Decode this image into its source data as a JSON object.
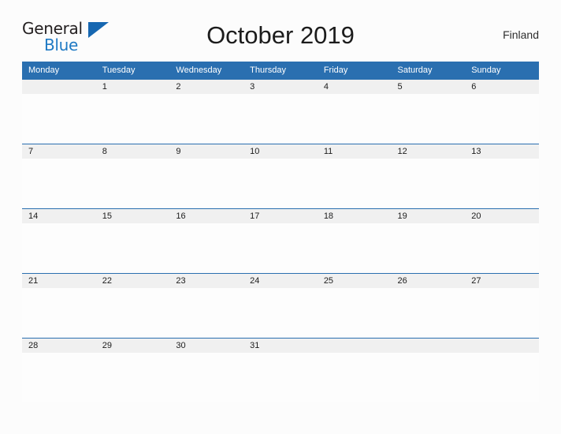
{
  "brand": {
    "name_part1": "General",
    "name_part2": "Blue",
    "flag_icon": "triangle-flag-icon",
    "accent_color": "#1667b1",
    "text_color": "#231f20"
  },
  "header": {
    "title": "October 2019",
    "country": "Finland"
  },
  "calendar": {
    "month": "October",
    "year": "2019",
    "header_bg": "#2a6fb0",
    "header_text_color": "#ffffff",
    "day_band_bg": "#f0f0f0",
    "weekday_headers": [
      "Monday",
      "Tuesday",
      "Wednesday",
      "Thursday",
      "Friday",
      "Saturday",
      "Sunday"
    ],
    "weeks": [
      [
        "",
        "1",
        "2",
        "3",
        "4",
        "5",
        "6"
      ],
      [
        "7",
        "8",
        "9",
        "10",
        "11",
        "12",
        "13"
      ],
      [
        "14",
        "15",
        "16",
        "17",
        "18",
        "19",
        "20"
      ],
      [
        "21",
        "22",
        "23",
        "24",
        "25",
        "26",
        "27"
      ],
      [
        "28",
        "29",
        "30",
        "31",
        "",
        "",
        ""
      ]
    ]
  }
}
